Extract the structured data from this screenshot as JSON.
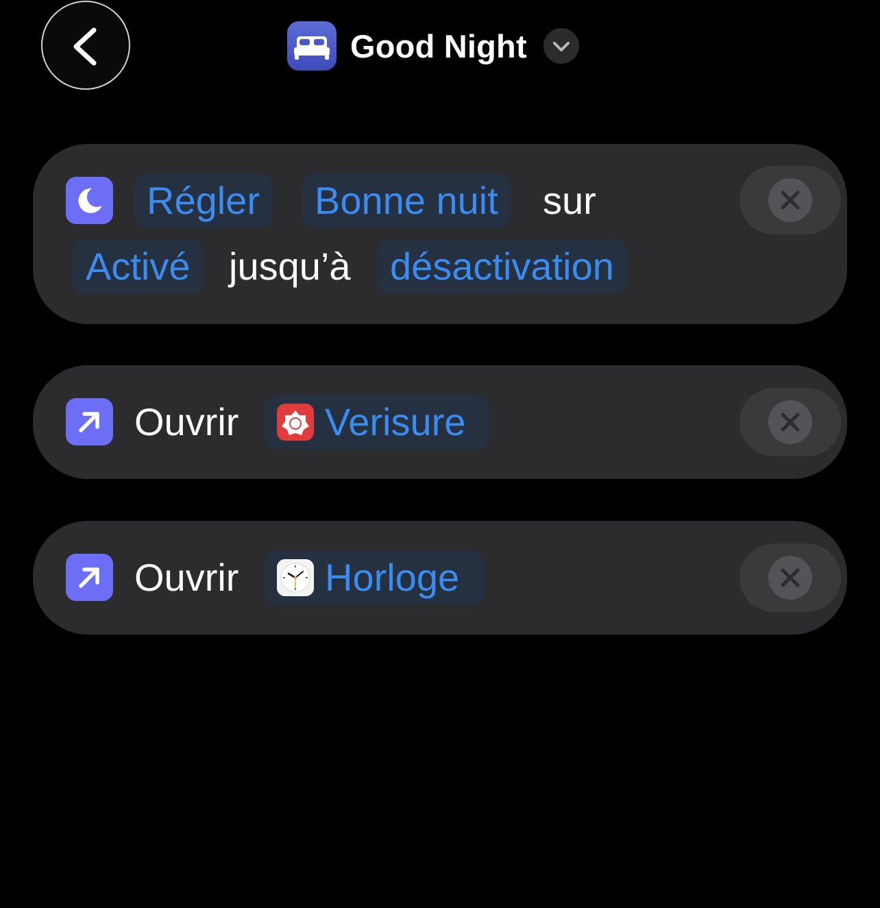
{
  "header": {
    "back_icon": "chevron-left-icon",
    "app_icon": "bed-icon",
    "title": "Good Night",
    "title_menu_icon": "chevron-down-icon"
  },
  "actions": [
    {
      "icon": "moon-icon",
      "verb": "Régler",
      "focus": "Bonne nuit",
      "connector_1": "sur",
      "state": "Activé",
      "connector_2": "jusqu’à",
      "until": "désactivation",
      "remove_icon": "close-icon"
    },
    {
      "icon": "arrow-up-right-icon",
      "verb": "Ouvrir",
      "app_icon": "verisure-app-icon",
      "app": "Verisure",
      "remove_icon": "close-icon"
    },
    {
      "icon": "arrow-up-right-icon",
      "verb": "Ouvrir",
      "app_icon": "clock-app-icon",
      "app": "Horloge",
      "remove_icon": "close-icon"
    }
  ],
  "colors": {
    "background": "#000000",
    "card": "#2c2c2e",
    "token_bg": "#253041",
    "token_text": "#3b8cf0",
    "action_icon": "#6c6ef5",
    "remove_bg": "#3a3a3c"
  }
}
